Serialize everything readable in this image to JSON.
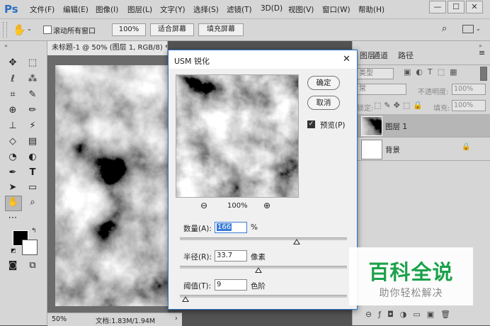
{
  "app": {
    "logo": "Ps"
  },
  "menubar": {
    "items": [
      "文件(F)",
      "编辑(E)",
      "图像(I)",
      "图层(L)",
      "文字(Y)",
      "选择(S)",
      "滤镜(T)",
      "3D(D)",
      "视图(V)",
      "窗口(W)",
      "帮助(H)"
    ],
    "window_buttons": [
      "—",
      "☐",
      "✕"
    ]
  },
  "options_bar": {
    "scroll_all_windows": "滚动所有窗口",
    "zoom_100": "100%",
    "fit_screen": "适合屏幕",
    "fill_screen": "填充屏幕"
  },
  "document": {
    "tab_title": "未标题-1 @ 50% (图层 1, RGB/8) *",
    "tab_close": "×",
    "zoom": "50%",
    "file_info": "文档:1.83M/1.94M",
    "status_arrow": "›"
  },
  "panels": {
    "tabs": [
      "图层",
      "通道",
      "路径"
    ],
    "kind_placeholder": "类型",
    "blend_placeholder": "常",
    "opacity_label": "不透明度:",
    "opacity_value": "100%",
    "lock_label": "锁定:",
    "fill_label": "填充:",
    "fill_value": "100%",
    "layers": [
      {
        "name": "图层 1"
      },
      {
        "name": "背景"
      }
    ]
  },
  "dialog": {
    "title": "USM 锐化",
    "close": "✕",
    "ok": "确定",
    "cancel": "取消",
    "preview_label": "预览(P)",
    "preview_checked": true,
    "zoom_value": "100%",
    "amount": {
      "label": "数量(A):",
      "value": "166",
      "unit": "%",
      "slider_fraction": 0.7
    },
    "radius": {
      "label": "半径(R):",
      "value": "33.7",
      "unit": "像素",
      "slider_fraction": 0.47
    },
    "threshold": {
      "label": "阈值(T):",
      "value": "9",
      "unit": "色阶",
      "slider_fraction": 0.035
    }
  },
  "watermark": {
    "title": "百科全说",
    "subtitle": "助你轻松解决",
    "color": "#1ba24a"
  },
  "colors": {
    "dialog_border": "#2b73c8",
    "ui_bg": "#d6d6d6",
    "ps_blue": "#2d6fbf"
  }
}
